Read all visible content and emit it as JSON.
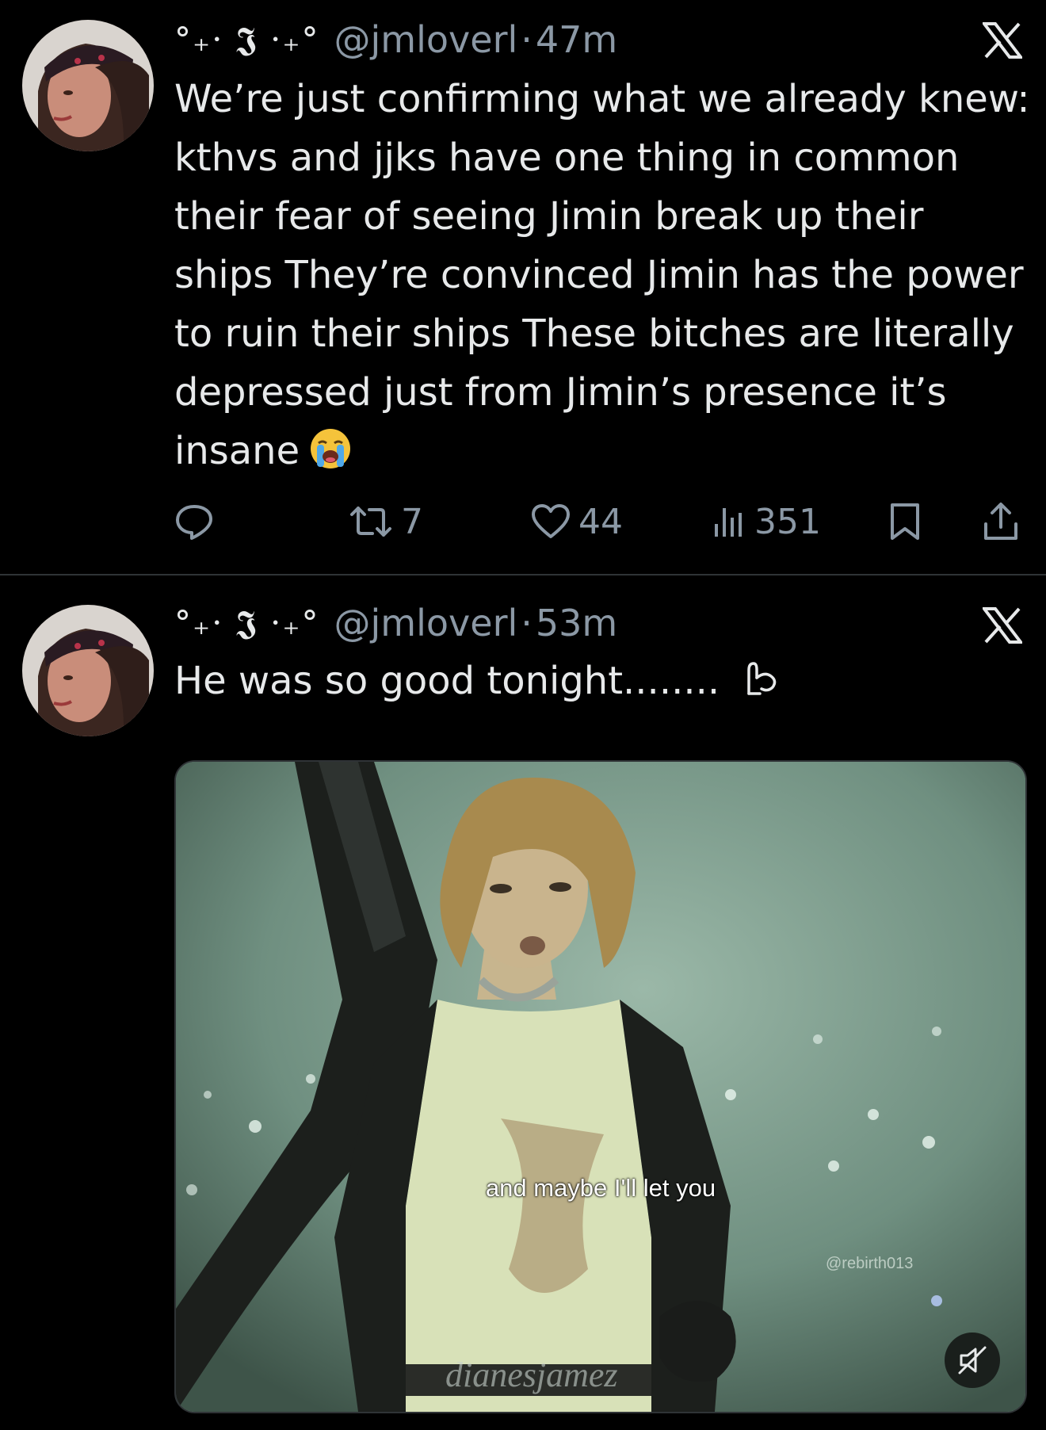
{
  "tweets": [
    {
      "author": {
        "display_name": "°₊· 𝕵 ·₊°",
        "handle": "@jmloverl",
        "avatar_icon": "avatar-photo"
      },
      "separator": "·",
      "time": "47m",
      "text": "We’re just confirming what we already knew: kthvs and jjks have one thing in common their fear of seeing Jimin break up their ships They’re convinced Jimin has the power to ruin their ships These bitches are literally depressed just from Jimin’s presence it’s insane",
      "emoji": "loudly-crying-face",
      "actions": {
        "replies": "",
        "retweets": "7",
        "likes": "44",
        "views": "351"
      }
    },
    {
      "author": {
        "display_name": "°₊· 𝕵 ·₊°",
        "handle": "@jmloverl",
        "avatar_icon": "avatar-photo"
      },
      "separator": "·",
      "time": "53m",
      "text": "He was so good tonight........ ",
      "emoji": "hand-gesture",
      "media": {
        "subtitle": "and maybe I'll let you",
        "watermark_handle": "@rebirth013",
        "watermark_signature": "dianesjamez",
        "muted": true
      }
    }
  ],
  "icons": {
    "platform": "x-logo",
    "reply": "reply-icon",
    "retweet": "retweet-icon",
    "like": "heart-icon",
    "views": "views-icon",
    "bookmark": "bookmark-icon",
    "share": "share-icon",
    "mute": "muted-speaker-icon"
  },
  "colors": {
    "background": "#000000",
    "text_primary": "#e7e9ea",
    "text_secondary": "#8b98a5",
    "divider": "#2f3336"
  }
}
